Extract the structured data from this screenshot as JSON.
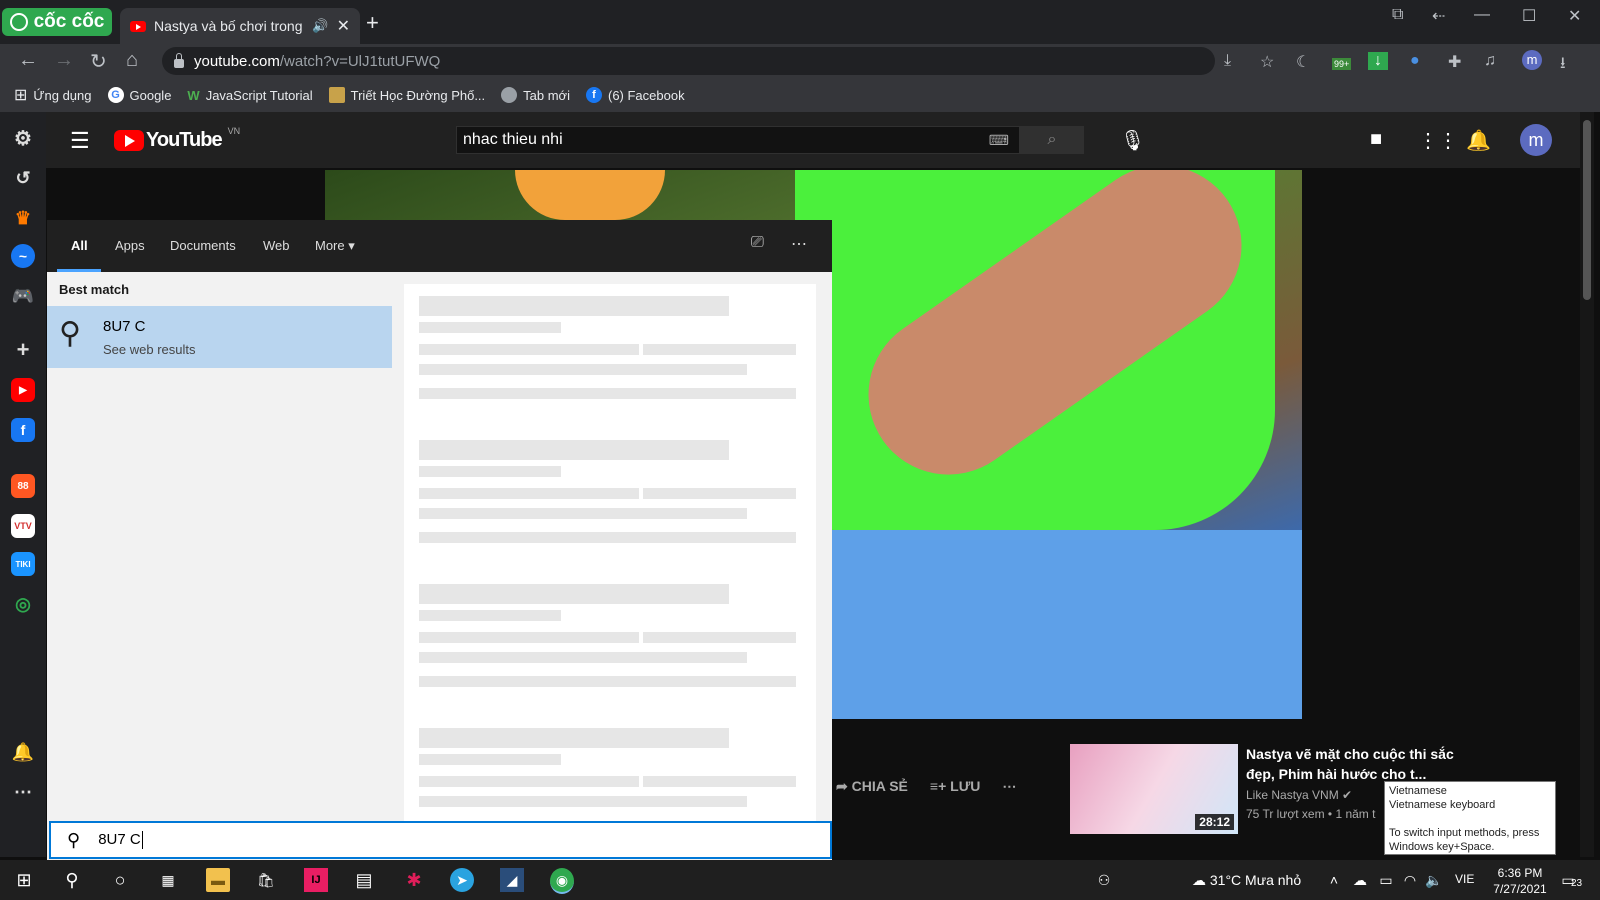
{
  "browser": {
    "brand": "cốc cốc",
    "tab_title": "Nastya và bố chơi trong",
    "url_host": "youtube.com",
    "url_path": "/watch?v=UlJ1tutUFWQ",
    "bookmarks": [
      {
        "label": "Ứng dụng",
        "icon": "apps-grid-icon"
      },
      {
        "label": "Google",
        "icon": "google-icon"
      },
      {
        "label": "JavaScript Tutorial",
        "icon": "w3-icon"
      },
      {
        "label": "Triết Học Đường Phố...",
        "icon": "page-icon"
      },
      {
        "label": "Tab mới",
        "icon": "globe-icon"
      },
      {
        "label": "(6) Facebook",
        "icon": "facebook-icon"
      }
    ],
    "extension_badge": "99+",
    "profile_initial": "m"
  },
  "youtube": {
    "logo": "YouTube",
    "region": "VN",
    "search_query": "nhac thieu nhi",
    "avatar_initial": "m",
    "actions": [
      "CHIA SẺ",
      "LƯU"
    ],
    "recommendation": {
      "title": "Nastya vẽ mặt cho cuộc thi sắc đẹp, Phim hài hước cho t...",
      "channel": "Like Nastya VNM",
      "meta": "75 Tr lượt xem • 1 năm t",
      "duration": "28:12"
    }
  },
  "search_panel": {
    "tabs": [
      "All",
      "Apps",
      "Documents",
      "Web",
      "More"
    ],
    "best_match_label": "Best match",
    "result_title": "8U7 C",
    "result_subtitle": "See web results",
    "query": "8U7 C"
  },
  "taskbar": {
    "weather": "31°C  Mưa nhỏ",
    "language": "VIE",
    "time": "6:36 PM",
    "date": "7/27/2021",
    "notification_count": "23"
  },
  "tooltip": {
    "line1": "Vietnamese",
    "line2": "Vietnamese keyboard",
    "line3": "To switch input methods, press Windows key+Space."
  },
  "colors": {
    "brand_green": "#2fa84f",
    "youtube_red": "#ff0000",
    "accent_blue": "#0078d7",
    "selection": "#b9d5ef"
  }
}
